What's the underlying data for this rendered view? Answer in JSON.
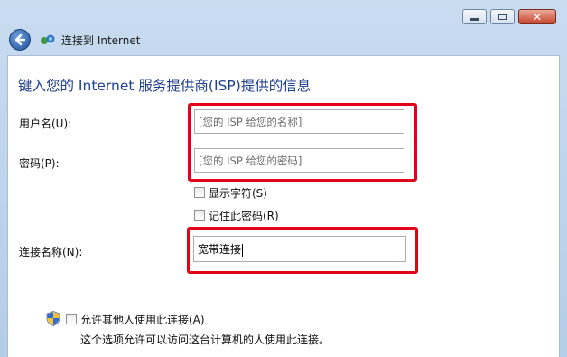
{
  "window": {
    "title": "连接到 Internet"
  },
  "page": {
    "heading": "键入您的 Internet 服务提供商(ISP)提供的信息"
  },
  "form": {
    "username_label": "用户名(U):",
    "username_placeholder": "[您的 ISP 给您的名称]",
    "password_label": "密码(P):",
    "password_placeholder": "[您的 ISP 给您的密码]",
    "show_chars_label": "显示字符(S)",
    "remember_password_label": "记住此密码(R)",
    "connection_name_label": "连接名称(N):",
    "connection_name_value": "宽带连接",
    "allow_others_label": "允许其他人使用此连接(A)",
    "allow_others_note": "这个选项允许可以访问这台计算机的人使用此连接。"
  },
  "colors": {
    "highlight": "#e2001a",
    "heading": "#1f3f8f"
  }
}
